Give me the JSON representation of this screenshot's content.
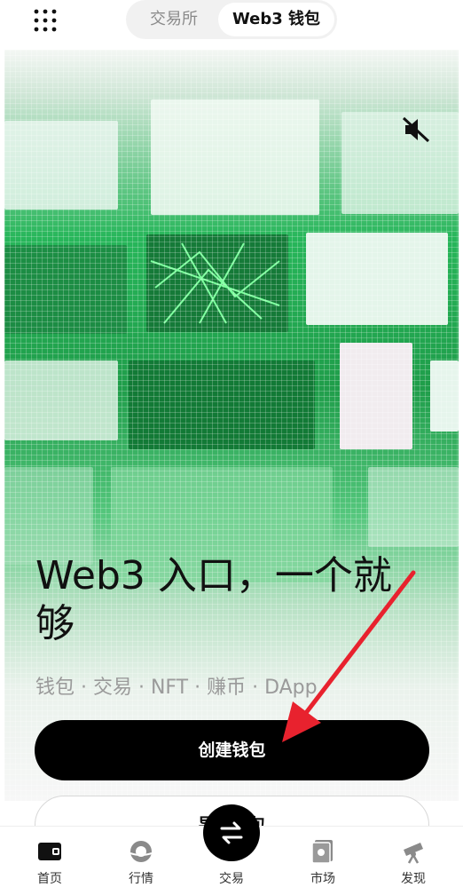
{
  "top_tabs": {
    "exchange": "交易所",
    "wallet": "Web3 钱包",
    "active": "wallet"
  },
  "hero": {
    "headline": "Web3 入口，一个就够",
    "subline": "钱包 · 交易 · NFT · 赚币 · DApp",
    "create_button": "创建钱包",
    "import_button": "导入钱包"
  },
  "icons": {
    "apps": "apps-grid-icon",
    "mute": "speaker-mute-icon",
    "annotation_arrow_color": "#e8222e"
  },
  "bottom_nav": {
    "items": [
      {
        "label": "首页",
        "icon": "wallet-home-icon"
      },
      {
        "label": "行情",
        "icon": "market-icon"
      },
      {
        "label": "交易",
        "icon": "swap-icon"
      },
      {
        "label": "市场",
        "icon": "nft-market-icon"
      },
      {
        "label": "发现",
        "icon": "telescope-icon"
      }
    ]
  }
}
